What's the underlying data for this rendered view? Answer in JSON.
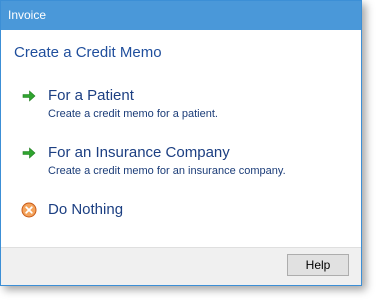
{
  "window": {
    "title": "Invoice"
  },
  "main": {
    "heading": "Create a Credit Memo",
    "commands": [
      {
        "label": "For a Patient",
        "description": "Create a credit memo for a patient.",
        "icon": "green-arrow-icon"
      },
      {
        "label": "For an Insurance Company",
        "description": "Create a credit memo for an insurance company.",
        "icon": "green-arrow-icon"
      },
      {
        "label": "Do Nothing",
        "icon": "cancel-icon"
      }
    ]
  },
  "footer": {
    "help_label": "Help"
  },
  "colors": {
    "titlebar": "#4a98d9",
    "link_text": "#1c3f82",
    "arrow": "#2fa52f",
    "cancel": "#e0772b"
  }
}
